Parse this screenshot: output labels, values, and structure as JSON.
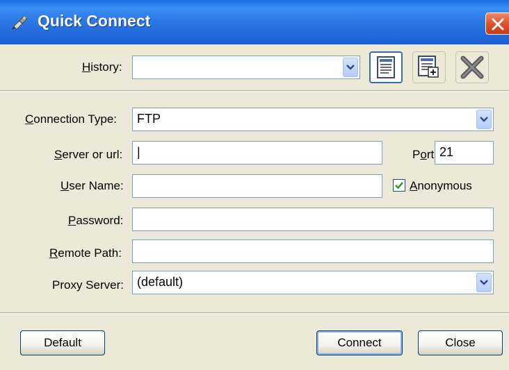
{
  "window": {
    "title": "Quick Connect"
  },
  "history": {
    "label_pre": "",
    "label_ul": "H",
    "label_post": "istory:",
    "value": ""
  },
  "connection_type": {
    "label_ul": "C",
    "label_post": "onnection Type:",
    "value": "FTP"
  },
  "server": {
    "label_ul": "S",
    "label_post": "erver or url:",
    "value": "",
    "cursor": "|"
  },
  "port": {
    "label_pre": "P",
    "label_ul": "o",
    "label_post": "rt",
    "value": "21"
  },
  "user_name": {
    "label_ul": "U",
    "label_post": "ser Name:",
    "value": ""
  },
  "anonymous": {
    "label_ul": "A",
    "label_post": "nonymous",
    "checked": true
  },
  "password": {
    "label_ul": "P",
    "label_post": "assword:",
    "value": ""
  },
  "remote_path": {
    "label_ul": "R",
    "label_post": "emote Path:",
    "value": ""
  },
  "proxy_server": {
    "label": "Proxy Server:",
    "value": "(default)"
  },
  "buttons": {
    "default": "Default",
    "connect": "Connect",
    "close": "Close"
  },
  "colors": {
    "titlebar": "#2a74e0",
    "dialog_bg": "#ece9d8",
    "field_border": "#7f9db9",
    "close_button": "#e0522c"
  },
  "icons": [
    "plug-icon",
    "close-window-icon",
    "dropdown-arrow-icon",
    "history-list-icon",
    "add-to-history-icon",
    "delete-history-icon",
    "checkmark-icon"
  ]
}
